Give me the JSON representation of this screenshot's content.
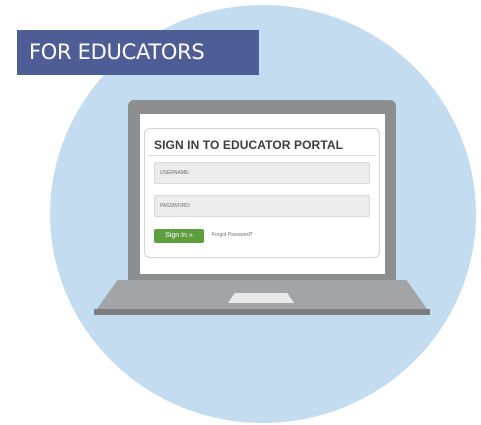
{
  "banner": {
    "label": "FOR EDUCATORS"
  },
  "portal": {
    "title": "SIGN IN TO EDUCATOR PORTAL",
    "username_label": "USERNAME:",
    "password_label": "PASSWORD:",
    "signin_label": "Sign In »",
    "forgot_label": "Forgot Password?"
  },
  "colors": {
    "banner": "#4f5d97",
    "circle": "#c4dcef",
    "signin_button": "#5f9e3e",
    "laptop": "#8d8e90"
  }
}
